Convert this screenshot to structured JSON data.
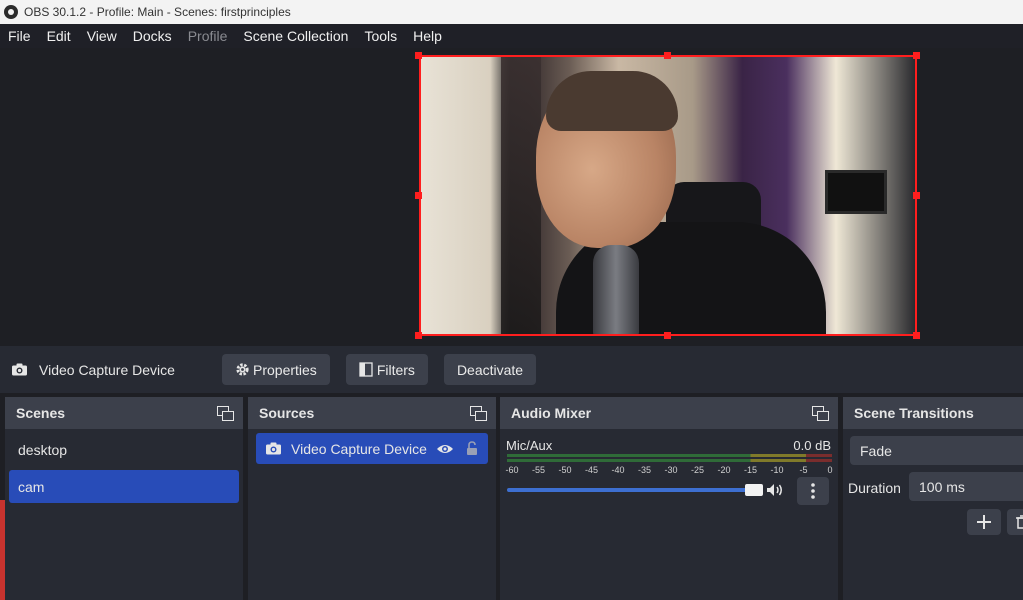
{
  "window": {
    "title": "OBS 30.1.2 - Profile: Main - Scenes: firstprinciples"
  },
  "menu": [
    {
      "label": "File",
      "enabled": true
    },
    {
      "label": "Edit",
      "enabled": true
    },
    {
      "label": "View",
      "enabled": true
    },
    {
      "label": "Docks",
      "enabled": true
    },
    {
      "label": "Profile",
      "enabled": false
    },
    {
      "label": "Scene Collection",
      "enabled": true
    },
    {
      "label": "Tools",
      "enabled": true
    },
    {
      "label": "Help",
      "enabled": true
    }
  ],
  "source_toolbar": {
    "source_name": "Video Capture Device",
    "properties_label": "Properties",
    "filters_label": "Filters",
    "deactivate_label": "Deactivate"
  },
  "scenes": {
    "title": "Scenes",
    "items": [
      {
        "label": "desktop",
        "selected": false
      },
      {
        "label": "cam",
        "selected": true
      }
    ]
  },
  "sources": {
    "title": "Sources",
    "items": [
      {
        "label": "Video Capture Device",
        "visible": true,
        "locked": false
      }
    ]
  },
  "audio_mixer": {
    "title": "Audio Mixer",
    "channel": {
      "name": "Mic/Aux",
      "level": "0.0 dB",
      "volume_fraction": 1.0
    },
    "scale_ticks": [
      "-60",
      "-55",
      "-50",
      "-45",
      "-40",
      "-35",
      "-30",
      "-25",
      "-20",
      "-15",
      "-10",
      "-5",
      "0"
    ]
  },
  "transitions": {
    "title": "Scene Transitions",
    "selected": "Fade",
    "duration_label": "Duration",
    "duration_value": "100 ms"
  },
  "colors": {
    "accent": "#284cb8",
    "selection_border": "#ff1e1e",
    "panel": "#272a33",
    "dock_header": "#3c404b"
  }
}
